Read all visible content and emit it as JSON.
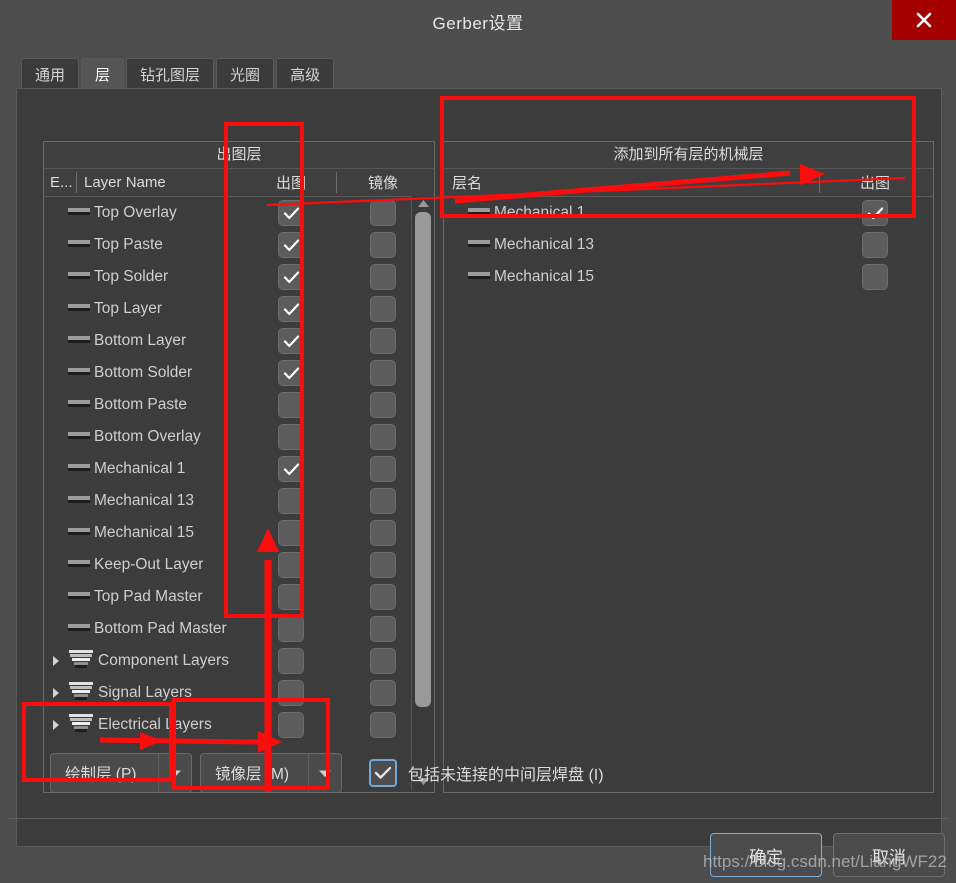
{
  "window": {
    "title": "Gerber设置",
    "close_icon": "close-icon",
    "accent_red": "#a40000",
    "annotation_red": "#fb0d0d",
    "background": "#4d4d4d"
  },
  "tabs": [
    {
      "label": "通用",
      "active": false
    },
    {
      "label": "层",
      "active": true
    },
    {
      "label": "钻孔图层",
      "active": false
    },
    {
      "label": "光圈",
      "active": false
    },
    {
      "label": "高级",
      "active": false
    }
  ],
  "left_panel": {
    "title": "出图层",
    "columns": [
      {
        "label": "E...",
        "name": "enable-column"
      },
      {
        "label": "Layer Name",
        "name": "layer-name-column"
      },
      {
        "label": "出图",
        "name": "plot-column"
      },
      {
        "label": "镜像",
        "name": "mirror-column"
      }
    ],
    "rows": [
      {
        "label": "Top Overlay",
        "icon": "layer-color-icon",
        "group": false,
        "plot": true,
        "mirror": false
      },
      {
        "label": "Top Paste",
        "icon": "layer-color-icon",
        "group": false,
        "plot": true,
        "mirror": false
      },
      {
        "label": "Top Solder",
        "icon": "layer-color-icon",
        "group": false,
        "plot": true,
        "mirror": false
      },
      {
        "label": "Top Layer",
        "icon": "layer-color-icon",
        "group": false,
        "plot": true,
        "mirror": false
      },
      {
        "label": "Bottom Layer",
        "icon": "layer-color-icon",
        "group": false,
        "plot": true,
        "mirror": false
      },
      {
        "label": "Bottom Solder",
        "icon": "layer-color-icon",
        "group": false,
        "plot": true,
        "mirror": false
      },
      {
        "label": "Bottom Paste",
        "icon": "layer-color-icon",
        "group": false,
        "plot": false,
        "mirror": false
      },
      {
        "label": "Bottom Overlay",
        "icon": "layer-color-icon",
        "group": false,
        "plot": false,
        "mirror": false
      },
      {
        "label": "Mechanical 1",
        "icon": "layer-color-icon",
        "group": false,
        "plot": true,
        "mirror": false
      },
      {
        "label": "Mechanical 13",
        "icon": "layer-color-icon",
        "group": false,
        "plot": false,
        "mirror": false
      },
      {
        "label": "Mechanical 15",
        "icon": "layer-color-icon",
        "group": false,
        "plot": false,
        "mirror": false
      },
      {
        "label": "Keep-Out Layer",
        "icon": "layer-color-icon",
        "group": false,
        "plot": false,
        "mirror": false
      },
      {
        "label": "Top Pad Master",
        "icon": "layer-color-icon",
        "group": false,
        "plot": false,
        "mirror": false
      },
      {
        "label": "Bottom Pad Master",
        "icon": "layer-color-icon",
        "group": false,
        "plot": false,
        "mirror": false
      },
      {
        "label": "Component Layers",
        "icon": "layer-stack-icon",
        "group": true,
        "plot": false,
        "mirror": false
      },
      {
        "label": "Signal Layers",
        "icon": "layer-stack-icon",
        "group": true,
        "plot": false,
        "mirror": false
      },
      {
        "label": "Electrical Layers",
        "icon": "layer-stack-icon",
        "group": true,
        "plot": false,
        "mirror": false
      }
    ],
    "scrollbar": {
      "up_icon": "scroll-up-icon",
      "down_icon": "scroll-down-icon",
      "thumb_top_pct": 0,
      "thumb_height_pct": 88
    }
  },
  "right_panel": {
    "title": "添加到所有层的机械层",
    "columns": [
      {
        "label": "层名",
        "name": "mech-layer-name-column"
      },
      {
        "label": "出图",
        "name": "mech-plot-column"
      }
    ],
    "rows": [
      {
        "label": "Mechanical 1",
        "icon": "layer-color-icon",
        "plot": true
      },
      {
        "label": "Mechanical 13",
        "icon": "layer-color-icon",
        "plot": false
      },
      {
        "label": "Mechanical 15",
        "icon": "layer-color-icon",
        "plot": false
      }
    ]
  },
  "bottom_controls": {
    "plot_layers": {
      "label": "绘制层 (P)",
      "arrow_icon": "chevron-down-icon"
    },
    "mirror_layers": {
      "label": "镜像层 (M)",
      "arrow_icon": "chevron-down-icon"
    },
    "include_pads": {
      "label": "包括未连接的中间层焊盘 (I)",
      "checked": true
    }
  },
  "footer": {
    "ok_label": "确定",
    "cancel_label": "取消"
  },
  "watermark": {
    "text": "https://blog.csdn.net/LiangWF22"
  }
}
